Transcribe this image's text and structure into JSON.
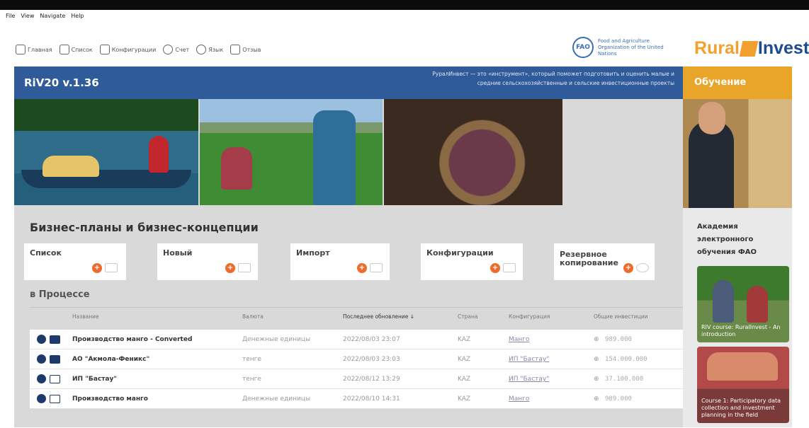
{
  "menubar": [
    "File",
    "View",
    "Navigate",
    "Help"
  ],
  "nav": [
    {
      "label": "Главная",
      "icon": "home-icon"
    },
    {
      "label": "Список",
      "icon": "list-icon"
    },
    {
      "label": "Конфигурации",
      "icon": "config-icon"
    },
    {
      "label": "Счет",
      "icon": "user-icon"
    },
    {
      "label": "Язык",
      "icon": "globe-icon"
    },
    {
      "label": "Отзыв",
      "icon": "feedback-icon"
    }
  ],
  "fao": {
    "text": "Food and Agriculture Organization of the United Nations",
    "logo": "FAO"
  },
  "brand": {
    "part1": "Rural",
    "part2": "Invest"
  },
  "header": {
    "version": "RiV20 v.1.36",
    "tagline": "РуралИнвест — это «инструмент», который поможет подготовить и оценить малые и средние сельскохозяйственные и сельские инвестиционные проекты"
  },
  "section_title": "Бизнес-планы и бизнес-концепции",
  "cards": [
    {
      "label": "Список"
    },
    {
      "label": "Новый"
    },
    {
      "label": "Импорт"
    },
    {
      "label": "Конфигурации"
    },
    {
      "label": "Резервное копирование"
    }
  ],
  "process_title": "в Процессе",
  "table": {
    "headers": [
      "Название",
      "Валюта",
      "Последнее обновление ↓",
      "Страна",
      "Конфигурация",
      "Общие инвестиции"
    ],
    "rows": [
      {
        "name": "Производство манго - Converted",
        "currency": "Денежные единицы",
        "updated": "2022/08/03 23:07",
        "country": "KAZ",
        "config": "Манго",
        "investment": "989.000",
        "folder": "full"
      },
      {
        "name": "АО \"Акмола-Феникс\"",
        "currency": "тенге",
        "updated": "2022/08/03 23:03",
        "country": "KAZ",
        "config": "ИП \"Бастау\"",
        "investment": "154.000.000",
        "folder": "full"
      },
      {
        "name": "ИП \"Бастау\"",
        "currency": "тенге",
        "updated": "2022/08/12 13:29",
        "country": "KAZ",
        "config": "ИП \"Бастау\"",
        "investment": "37.100.000",
        "folder": "empty"
      },
      {
        "name": "Производство манго",
        "currency": "Денежные единицы",
        "updated": "2022/08/10 14:31",
        "country": "KAZ",
        "config": "Манго",
        "investment": "989.000",
        "folder": "empty"
      }
    ]
  },
  "sidebar": {
    "title": "Обучение",
    "academy": "Академия электронного обучения ФАО",
    "thumbs": [
      {
        "text": "RIV course: RuralInvest - An introduction"
      },
      {
        "text": "Course 1: Participatory data collection and investment planning in the field"
      }
    ]
  },
  "colors": {
    "header_blue": "#2f5b9a",
    "sidebar_orange": "#e8a52a",
    "accent_orange": "#ec6b2d",
    "dark_navy": "#1d3a6b"
  }
}
